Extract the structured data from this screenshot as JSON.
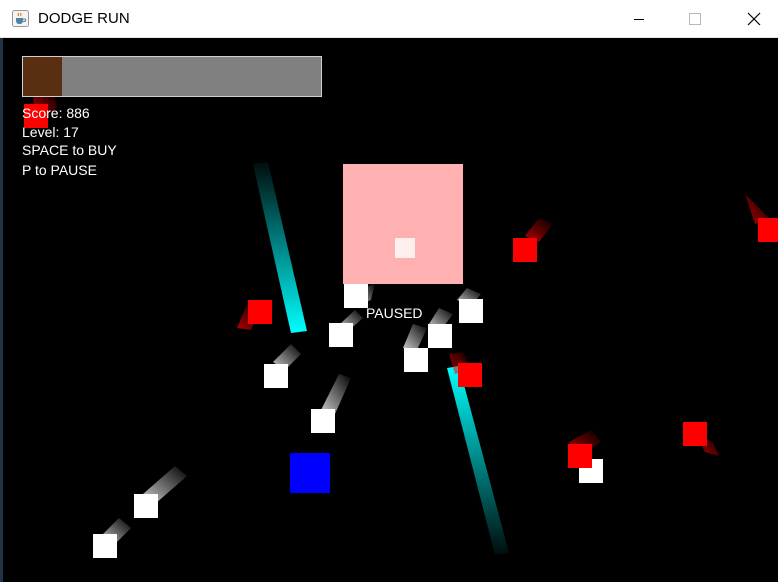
{
  "window": {
    "title": "DODGE RUN",
    "app_icon": "java-coffee-cup-icon",
    "controls": [
      "minimize-icon",
      "maximize-icon",
      "close-icon"
    ]
  },
  "hud": {
    "score": "Score: 886",
    "level": "Level: 17",
    "buy_hint": "SPACE to BUY",
    "pause_hint": "P to PAUSE",
    "power_bar_fraction": 0.13
  },
  "status": {
    "paused": "PAUSED"
  },
  "colors": {
    "background": "#000000",
    "player": "#0000ff",
    "enemy": "#ff0000",
    "pickup": "#ffffff",
    "laser": "#00ffff",
    "boss": "#ffb0b0",
    "power_bar_fill": "#5a2e10",
    "power_bar_empty": "#808080"
  }
}
